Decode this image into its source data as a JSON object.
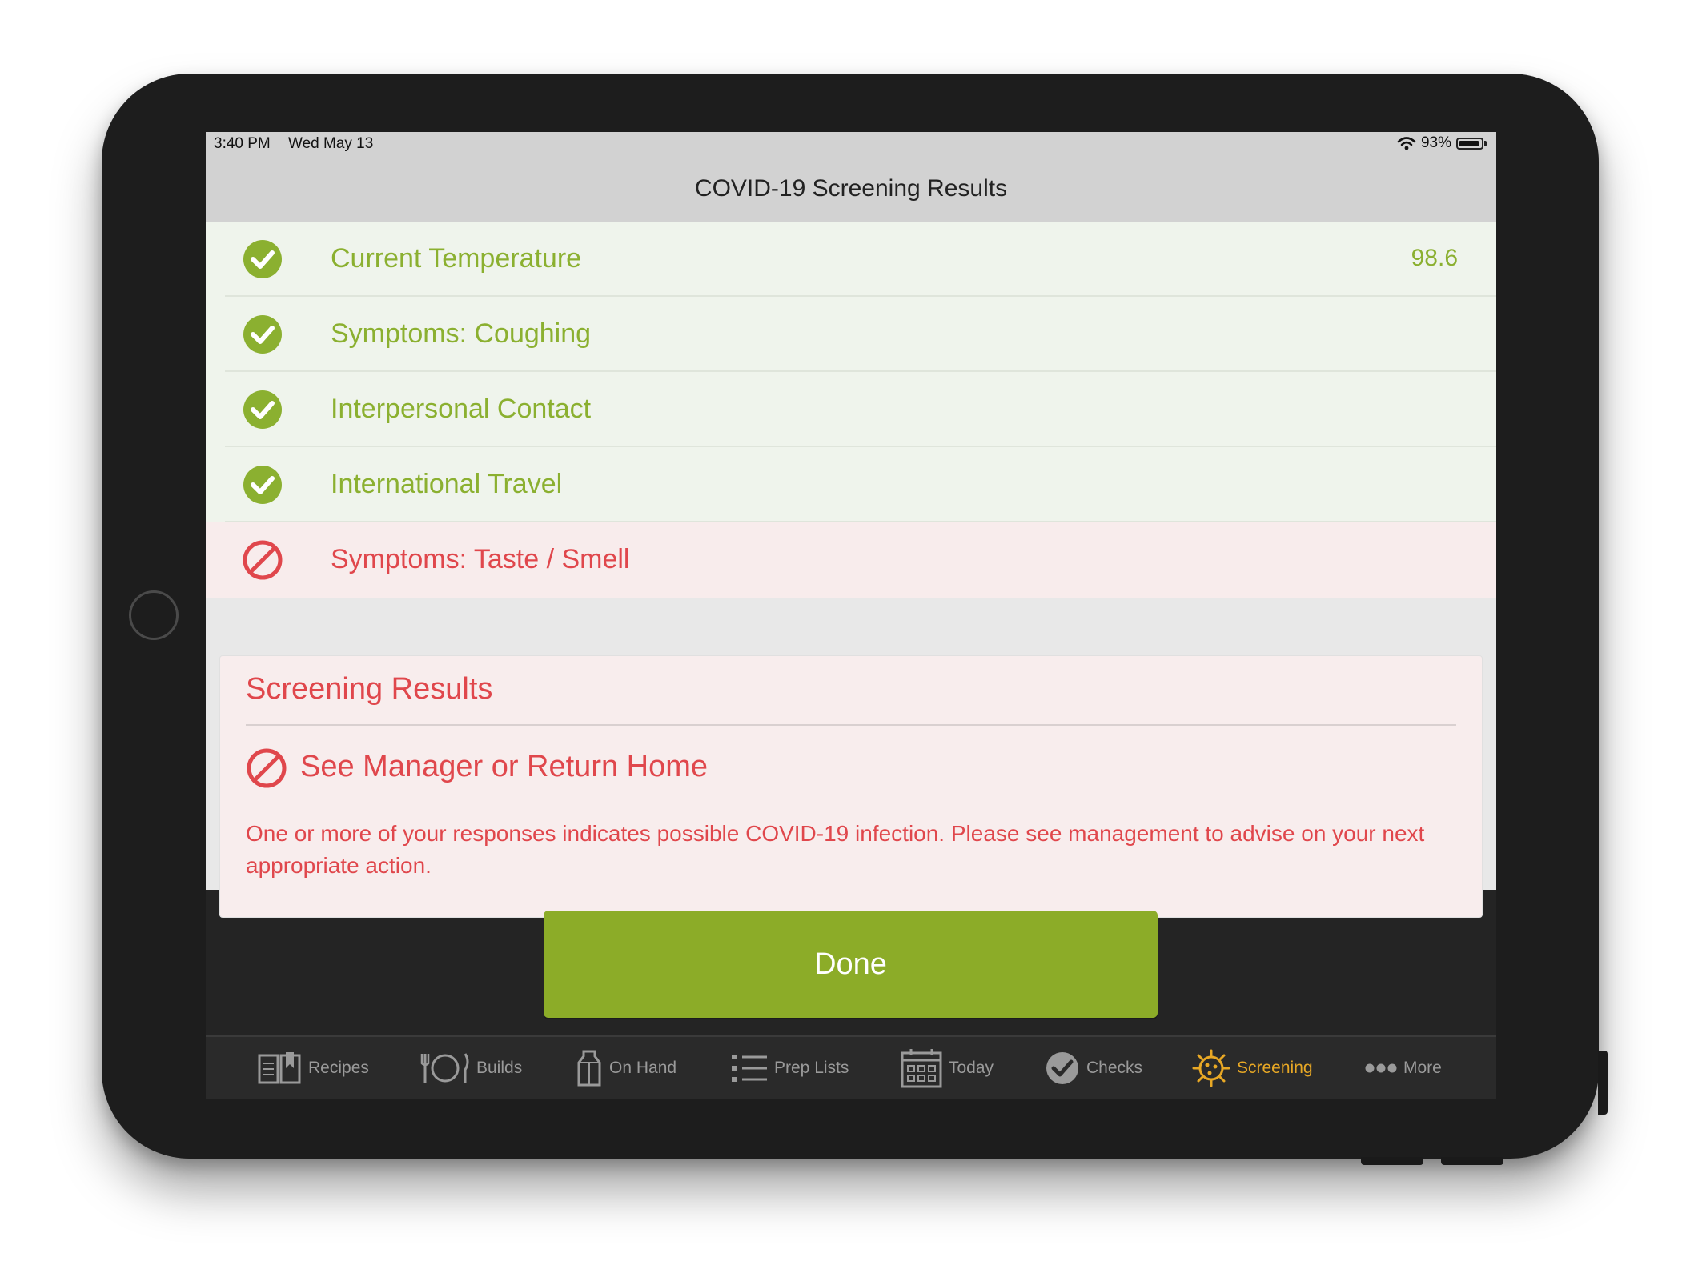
{
  "status_bar": {
    "time": "3:40 PM",
    "date": "Wed May 13",
    "battery": "93%",
    "battery_level": 0.93
  },
  "nav": {
    "title": "COVID-19 Screening Results"
  },
  "rows": [
    {
      "label": "Current Temperature",
      "value": "98.6",
      "status": "pass"
    },
    {
      "label": "Symptoms: Coughing",
      "value": "",
      "status": "pass"
    },
    {
      "label": "Interpersonal Contact",
      "value": "",
      "status": "pass"
    },
    {
      "label": "International Travel",
      "value": "",
      "status": "pass"
    },
    {
      "label": "Symptoms: Taste / Smell",
      "value": "",
      "status": "fail"
    }
  ],
  "results": {
    "title": "Screening Results",
    "heading": "See Manager or Return Home",
    "message": "One or more of your responses indicates possible COVID-19 infection.  Please see management to advise on your next appropriate action."
  },
  "done_label": "Done",
  "tabs": [
    {
      "label": "Recipes",
      "icon": "recipes-book-icon",
      "active": false
    },
    {
      "label": "Builds",
      "icon": "fork-plate-knife-icon",
      "active": false
    },
    {
      "label": "On Hand",
      "icon": "carton-icon",
      "active": false
    },
    {
      "label": "Prep Lists",
      "icon": "list-icon",
      "active": false
    },
    {
      "label": "Today",
      "icon": "calendar-icon",
      "active": false
    },
    {
      "label": "Checks",
      "icon": "checkmark-circle-icon",
      "active": false
    },
    {
      "label": "Screening",
      "icon": "virus-icon",
      "active": true
    },
    {
      "label": "More",
      "icon": "ellipsis-icon",
      "active": false
    }
  ],
  "colors": {
    "pass": "#8bb030",
    "fail": "#e0474c",
    "done_button": "#8cac28",
    "active_tab": "#e8a825",
    "inactive_tab": "#9a9a9a"
  }
}
